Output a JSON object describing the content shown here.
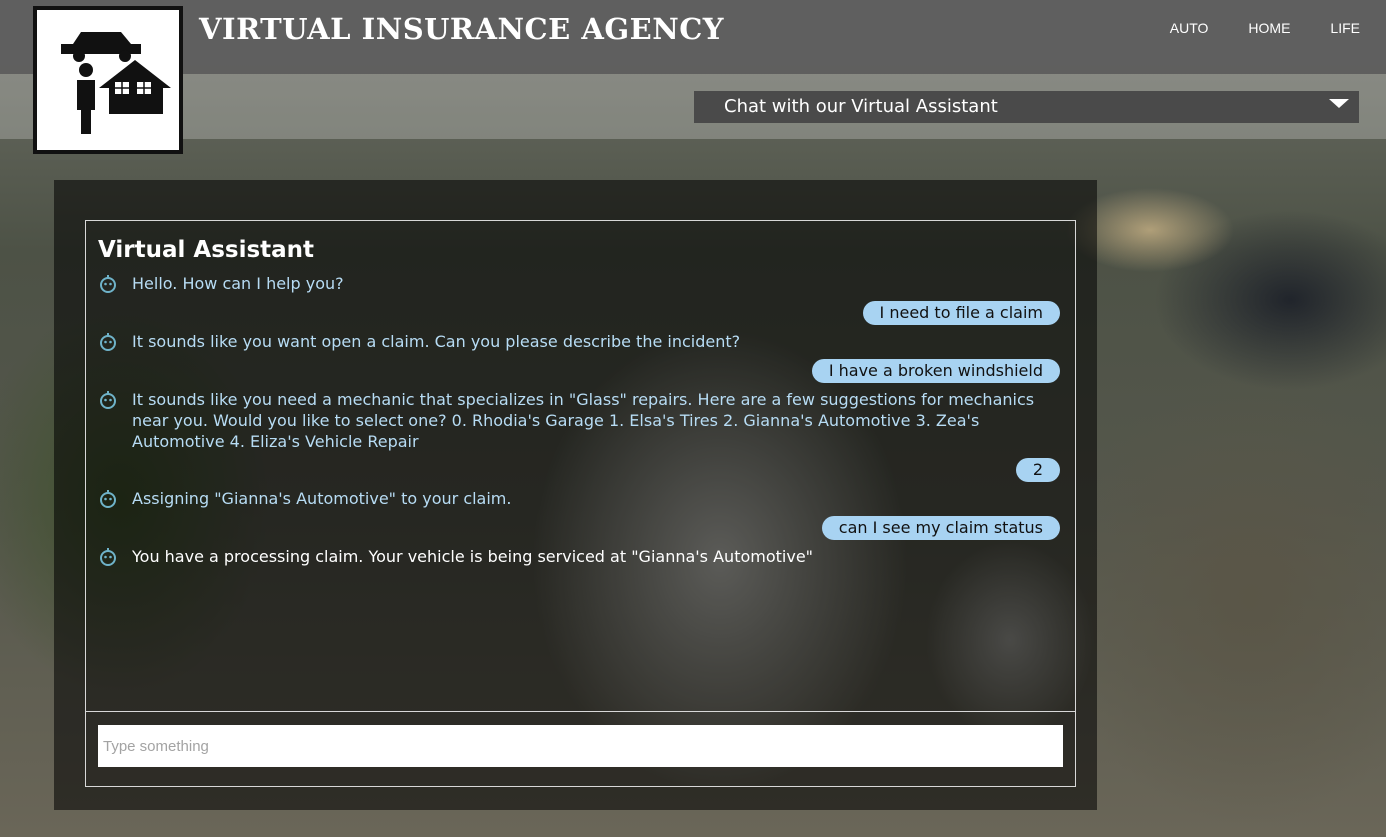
{
  "site": {
    "title": "VIRTUAL INSURANCE AGENCY",
    "nav": [
      "AUTO",
      "HOME",
      "LIFE"
    ]
  },
  "chat_toggle": {
    "label": "Chat with our Virtual Assistant",
    "icon": "caret-down-icon"
  },
  "chat": {
    "title": "Virtual Assistant",
    "bot_avatar_icon": "robot-icon",
    "messages": [
      {
        "from": "bot",
        "text": "Hello. How can I help you?"
      },
      {
        "from": "user",
        "text": "I need to file a claim"
      },
      {
        "from": "bot",
        "text": "It sounds like you want open a claim. Can you please describe the incident?"
      },
      {
        "from": "user",
        "text": "I have a broken windshield"
      },
      {
        "from": "bot",
        "text": "It sounds like you need a mechanic that specializes in \"Glass\" repairs. Here are a few suggestions for mechanics near you. Would you like to select one? 0. Rhodia's Garage 1. Elsa's Tires 2. Gianna's Automotive 3. Zea's Automotive 4. Eliza's Vehicle Repair"
      },
      {
        "from": "user",
        "text": "2"
      },
      {
        "from": "bot",
        "text": "Assigning \"Gianna's Automotive\" to your claim."
      },
      {
        "from": "user",
        "text": "can I see my claim status"
      },
      {
        "from": "bot",
        "text": "You have a processing claim. Your vehicle is being serviced at \"Gianna's Automotive\""
      }
    ],
    "input": {
      "placeholder": "Type something",
      "value": ""
    }
  },
  "colors": {
    "bot_text": "#b7dcf4",
    "bot_text_latest": "#ffffff",
    "user_bubble": "#a8d3f2",
    "topbar": "#5f5f5f"
  }
}
